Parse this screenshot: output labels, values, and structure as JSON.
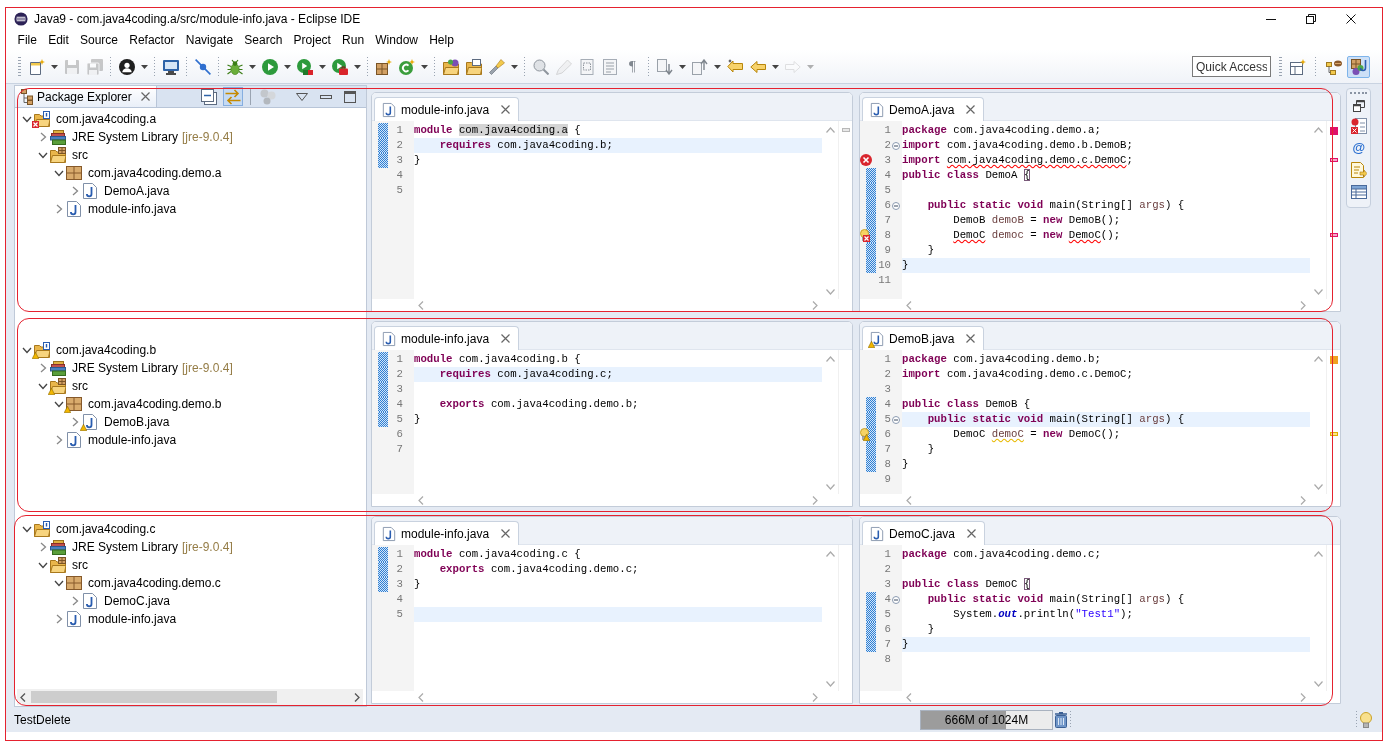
{
  "window": {
    "title": "Java9 - com.java4coding.a/src/module-info.java - Eclipse IDE"
  },
  "menu": [
    "File",
    "Edit",
    "Source",
    "Refactor",
    "Navigate",
    "Search",
    "Project",
    "Run",
    "Window",
    "Help"
  ],
  "toolbar": [
    [
      {
        "kind": "new",
        "dropdown": true,
        "disabled": false
      },
      {
        "kind": "save",
        "dropdown": false,
        "disabled": true
      },
      {
        "kind": "save-all",
        "dropdown": false,
        "disabled": true
      }
    ],
    [
      {
        "kind": "profile",
        "dropdown": true,
        "disabled": false
      }
    ],
    [
      {
        "kind": "console",
        "dropdown": false,
        "disabled": false
      }
    ],
    [
      {
        "kind": "skip-breakpoints",
        "dropdown": false,
        "disabled": false
      }
    ],
    [
      {
        "kind": "debug",
        "dropdown": true,
        "disabled": false
      },
      {
        "kind": "run",
        "dropdown": true,
        "disabled": false
      },
      {
        "kind": "coverage",
        "dropdown": true,
        "disabled": false
      },
      {
        "kind": "external-tools",
        "dropdown": true,
        "disabled": false
      }
    ],
    [
      {
        "kind": "new-package",
        "dropdown": false,
        "disabled": false
      },
      {
        "kind": "new-class",
        "dropdown": true,
        "disabled": false
      }
    ],
    [
      {
        "kind": "open-type",
        "dropdown": false,
        "disabled": false
      },
      {
        "kind": "open-task",
        "dropdown": false,
        "disabled": false
      },
      {
        "kind": "search",
        "dropdown": true,
        "disabled": false
      }
    ],
    [
      {
        "kind": "breadcrumb",
        "dropdown": false,
        "disabled": false
      },
      {
        "kind": "mark-occurrences",
        "dropdown": false,
        "disabled": true
      },
      {
        "kind": "block-selection",
        "dropdown": false,
        "disabled": false
      },
      {
        "kind": "word-wrap",
        "dropdown": false,
        "disabled": false
      },
      {
        "kind": "whitespace",
        "label": "¶",
        "dropdown": false,
        "disabled": false
      }
    ],
    [
      {
        "kind": "next-annotation",
        "dropdown": true,
        "disabled": false
      },
      {
        "kind": "previous-annotation",
        "dropdown": true,
        "disabled": false
      },
      {
        "kind": "last-edit",
        "dropdown": false,
        "disabled": false
      },
      {
        "kind": "back",
        "dropdown": true,
        "disabled": false
      },
      {
        "kind": "forward",
        "dropdown": true,
        "disabled": true
      }
    ]
  ],
  "quick_access": {
    "placeholder": "Quick Access"
  },
  "perspectives": [
    {
      "kind": "open-perspective",
      "selected": false
    },
    {
      "kind": "hierarchy",
      "selected": false
    },
    {
      "kind": "java",
      "selected": true
    }
  ],
  "package_explorer": {
    "title": "Package Explorer",
    "view_toolbar": [
      {
        "kind": "collapse-all",
        "selected": false
      },
      {
        "kind": "link-with-editor",
        "selected": true
      },
      {
        "kind": "focus-task",
        "selected": false
      },
      {
        "kind": "view-menu",
        "selected": false
      },
      {
        "kind": "minimize",
        "selected": false
      },
      {
        "kind": "maximize",
        "selected": false
      }
    ],
    "projects": [
      {
        "label": "com.java4coding.a",
        "kind": "project",
        "error": true,
        "warning": false,
        "expanded": true,
        "children": [
          {
            "label": "JRE System Library",
            "decoration": "[jre-9.0.4]",
            "kind": "library",
            "error": false,
            "warning": false,
            "expanded": false
          },
          {
            "label": "src",
            "kind": "source-folder",
            "error": false,
            "warning": false,
            "expanded": true,
            "children": [
              {
                "label": "com.java4coding.demo.a",
                "kind": "package",
                "error": false,
                "warning": false,
                "expanded": true,
                "children": [
                  {
                    "label": "DemoA.java",
                    "kind": "java-file",
                    "error": false,
                    "warning": false,
                    "expanded": false
                  }
                ]
              },
              {
                "label": "module-info.java",
                "kind": "java-file",
                "error": false,
                "warning": false,
                "expanded": false
              }
            ]
          }
        ]
      },
      {
        "label": "com.java4coding.b",
        "kind": "project",
        "error": false,
        "warning": true,
        "expanded": true,
        "children": [
          {
            "label": "JRE System Library",
            "decoration": "[jre-9.0.4]",
            "kind": "library",
            "error": false,
            "warning": false,
            "expanded": false
          },
          {
            "label": "src",
            "kind": "source-folder",
            "error": false,
            "warning": true,
            "expanded": true,
            "children": [
              {
                "label": "com.java4coding.demo.b",
                "kind": "package",
                "error": false,
                "warning": true,
                "expanded": true,
                "children": [
                  {
                    "label": "DemoB.java",
                    "kind": "java-file",
                    "error": false,
                    "warning": true,
                    "expanded": false
                  }
                ]
              },
              {
                "label": "module-info.java",
                "kind": "java-file",
                "error": false,
                "warning": false,
                "expanded": false
              }
            ]
          }
        ]
      },
      {
        "label": "com.java4coding.c",
        "kind": "project",
        "error": false,
        "warning": false,
        "expanded": true,
        "children": [
          {
            "label": "JRE System Library",
            "decoration": "[jre-9.0.4]",
            "kind": "library",
            "error": false,
            "warning": false,
            "expanded": false
          },
          {
            "label": "src",
            "kind": "source-folder",
            "error": false,
            "warning": false,
            "expanded": true,
            "children": [
              {
                "label": "com.java4coding.demo.c",
                "kind": "package",
                "error": false,
                "warning": false,
                "expanded": true,
                "children": [
                  {
                    "label": "DemoC.java",
                    "kind": "java-file",
                    "error": false,
                    "warning": false,
                    "expanded": false
                  }
                ]
              },
              {
                "label": "module-info.java",
                "kind": "java-file",
                "error": false,
                "warning": false,
                "expanded": false
              }
            ]
          }
        ]
      }
    ]
  },
  "editor_rows": [
    {
      "editors": [
        {
          "tab": {
            "title": "module-info.java",
            "error": false,
            "warning": false
          },
          "lines": [
            {
              "number": "1",
              "tokens": [
                {
                  "kind": "keyword",
                  "text": "module "
                },
                {
                  "kind": "occurrence",
                  "text": "com.java4coding.a"
                },
                {
                  "kind": "plain",
                  "text": " {"
                }
              ],
              "current": false,
              "changed": true,
              "fold": false,
              "error": false,
              "warning": false,
              "quickfix": false
            },
            {
              "number": "2",
              "tokens": [
                {
                  "kind": "keyword",
                  "text": "    requires"
                },
                {
                  "kind": "plain",
                  "text": " com.java4coding.b;"
                }
              ],
              "current": true,
              "changed": true,
              "fold": false,
              "error": false,
              "warning": false,
              "quickfix": false
            },
            {
              "number": "3",
              "tokens": [
                {
                  "kind": "plain",
                  "text": "}"
                }
              ],
              "current": false,
              "changed": true,
              "fold": false,
              "error": false,
              "warning": false,
              "quickfix": false
            },
            {
              "number": "4",
              "current": false,
              "changed": false,
              "fold": false,
              "error": false,
              "warning": false,
              "quickfix": false
            },
            {
              "number": "5",
              "current": false,
              "changed": false,
              "fold": false,
              "error": false,
              "warning": false,
              "quickfix": false
            }
          ]
        },
        {
          "tab": {
            "title": "DemoA.java",
            "error": false,
            "warning": false
          },
          "lines": [
            {
              "number": "1",
              "tokens": [
                {
                  "kind": "keyword",
                  "text": "package"
                },
                {
                  "kind": "plain",
                  "text": " com.java4coding.demo.a;"
                }
              ],
              "current": false,
              "changed": false,
              "fold": false,
              "error": false,
              "warning": false,
              "quickfix": false
            },
            {
              "number": "2",
              "tokens": [
                {
                  "kind": "keyword",
                  "text": "import"
                },
                {
                  "kind": "plain",
                  "text": " com.java4coding.demo.b.DemoB;"
                }
              ],
              "current": false,
              "changed": false,
              "fold": true,
              "error": false,
              "warning": false,
              "quickfix": false
            },
            {
              "number": "3",
              "tokens": [
                {
                  "kind": "keyword",
                  "text": "import "
                },
                {
                  "kind": "error",
                  "text": "com.java4coding.demo.c.DemoC"
                },
                {
                  "kind": "plain",
                  "text": ";"
                }
              ],
              "current": false,
              "changed": false,
              "fold": false,
              "error": true,
              "warning": false,
              "quickfix": false
            },
            {
              "number": "4",
              "tokens": [
                {
                  "kind": "keyword",
                  "text": "public class"
                },
                {
                  "kind": "plain",
                  "text": " DemoA "
                },
                {
                  "kind": "bracket",
                  "text": "{"
                }
              ],
              "current": false,
              "changed": true,
              "fold": false,
              "error": false,
              "warning": false,
              "quickfix": false
            },
            {
              "number": "5",
              "current": false,
              "changed": true,
              "fold": false,
              "error": false,
              "warning": false,
              "quickfix": false
            },
            {
              "number": "6",
              "tokens": [
                {
                  "kind": "keyword",
                  "text": "    public static void"
                },
                {
                  "kind": "plain",
                  "text": " main(String[] "
                },
                {
                  "kind": "variable",
                  "text": "args"
                },
                {
                  "kind": "plain",
                  "text": ") {"
                }
              ],
              "current": false,
              "changed": true,
              "fold": true,
              "error": false,
              "warning": false,
              "quickfix": false
            },
            {
              "number": "7",
              "tokens": [
                {
                  "kind": "plain",
                  "text": "        DemoB "
                },
                {
                  "kind": "variable",
                  "text": "demoB"
                },
                {
                  "kind": "plain",
                  "text": " = "
                },
                {
                  "kind": "keyword",
                  "text": "new"
                },
                {
                  "kind": "plain",
                  "text": " DemoB();"
                }
              ],
              "current": false,
              "changed": true,
              "fold": false,
              "error": false,
              "warning": false,
              "quickfix": false
            },
            {
              "number": "8",
              "tokens": [
                {
                  "kind": "error",
                  "text": "        DemoC"
                },
                {
                  "kind": "variable",
                  "text": " democ"
                },
                {
                  "kind": "plain",
                  "text": " = "
                },
                {
                  "kind": "keyword",
                  "text": "new "
                },
                {
                  "kind": "error",
                  "text": "DemoC"
                },
                {
                  "kind": "plain",
                  "text": "();"
                }
              ],
              "current": false,
              "changed": true,
              "fold": false,
              "error": true,
              "warning": false,
              "quickfix": true
            },
            {
              "number": "9",
              "tokens": [
                {
                  "kind": "plain",
                  "text": "    }"
                }
              ],
              "current": false,
              "changed": true,
              "fold": false,
              "error": false,
              "warning": false,
              "quickfix": false
            },
            {
              "number": "10",
              "tokens": [
                {
                  "kind": "plain",
                  "text": "}"
                }
              ],
              "current": true,
              "changed": true,
              "fold": false,
              "error": false,
              "warning": false,
              "quickfix": false
            },
            {
              "number": "11",
              "current": false,
              "changed": false,
              "fold": false,
              "error": false,
              "warning": false,
              "quickfix": false
            }
          ]
        }
      ]
    },
    {
      "editors": [
        {
          "tab": {
            "title": "module-info.java",
            "error": false,
            "warning": false
          },
          "lines": [
            {
              "number": "1",
              "tokens": [
                {
                  "kind": "keyword",
                  "text": "module"
                },
                {
                  "kind": "plain",
                  "text": " com.java4coding.b {"
                }
              ],
              "current": false,
              "changed": true,
              "fold": false,
              "error": false,
              "warning": false,
              "quickfix": false
            },
            {
              "number": "2",
              "tokens": [
                {
                  "kind": "keyword",
                  "text": "    requires"
                },
                {
                  "kind": "plain",
                  "text": " com.java4coding.c;"
                }
              ],
              "current": true,
              "changed": true,
              "fold": false,
              "error": false,
              "warning": false,
              "quickfix": false
            },
            {
              "number": "3",
              "current": false,
              "changed": true,
              "fold": false,
              "error": false,
              "warning": false,
              "quickfix": false
            },
            {
              "number": "4",
              "tokens": [
                {
                  "kind": "keyword",
                  "text": "    exports"
                },
                {
                  "kind": "plain",
                  "text": " com.java4coding.demo.b;"
                }
              ],
              "current": false,
              "changed": true,
              "fold": false,
              "error": false,
              "warning": false,
              "quickfix": false
            },
            {
              "number": "5",
              "tokens": [
                {
                  "kind": "plain",
                  "text": "}"
                }
              ],
              "current": false,
              "changed": true,
              "fold": false,
              "error": false,
              "warning": false,
              "quickfix": false
            },
            {
              "number": "6",
              "current": false,
              "changed": false,
              "fold": false,
              "error": false,
              "warning": false,
              "quickfix": false
            },
            {
              "number": "7",
              "current": false,
              "changed": false,
              "fold": false,
              "error": false,
              "warning": false,
              "quickfix": false
            }
          ]
        },
        {
          "tab": {
            "title": "DemoB.java",
            "error": false,
            "warning": true
          },
          "lines": [
            {
              "number": "1",
              "tokens": [
                {
                  "kind": "keyword",
                  "text": "package"
                },
                {
                  "kind": "plain",
                  "text": " com.java4coding.demo.b;"
                }
              ],
              "current": false,
              "changed": false,
              "fold": false,
              "error": false,
              "warning": false,
              "quickfix": false
            },
            {
              "number": "2",
              "tokens": [
                {
                  "kind": "keyword",
                  "text": "import"
                },
                {
                  "kind": "plain",
                  "text": " com.java4coding.demo.c.DemoC;"
                }
              ],
              "current": false,
              "changed": false,
              "fold": false,
              "error": false,
              "warning": false,
              "quickfix": false
            },
            {
              "number": "3",
              "current": false,
              "changed": false,
              "fold": false,
              "error": false,
              "warning": false,
              "quickfix": false
            },
            {
              "number": "4",
              "tokens": [
                {
                  "kind": "keyword",
                  "text": "public class"
                },
                {
                  "kind": "plain",
                  "text": " DemoB {"
                }
              ],
              "current": false,
              "changed": true,
              "fold": false,
              "error": false,
              "warning": false,
              "quickfix": false
            },
            {
              "number": "5",
              "tokens": [
                {
                  "kind": "keyword",
                  "text": "    public static void"
                },
                {
                  "kind": "plain",
                  "text": " main(String[] "
                },
                {
                  "kind": "variable",
                  "text": "args"
                },
                {
                  "kind": "plain",
                  "text": ") {"
                }
              ],
              "current": true,
              "changed": true,
              "fold": true,
              "error": false,
              "warning": false,
              "quickfix": false
            },
            {
              "number": "6",
              "tokens": [
                {
                  "kind": "plain",
                  "text": "        DemoC "
                },
                {
                  "kind": "warning",
                  "text": "demoC"
                },
                {
                  "kind": "plain",
                  "text": " = "
                },
                {
                  "kind": "keyword",
                  "text": "new"
                },
                {
                  "kind": "plain",
                  "text": " DemoC();"
                }
              ],
              "current": false,
              "changed": true,
              "fold": false,
              "error": false,
              "warning": true,
              "quickfix": true
            },
            {
              "number": "7",
              "tokens": [
                {
                  "kind": "plain",
                  "text": "    }"
                }
              ],
              "current": false,
              "changed": true,
              "fold": false,
              "error": false,
              "warning": false,
              "quickfix": false
            },
            {
              "number": "8",
              "tokens": [
                {
                  "kind": "plain",
                  "text": "}"
                }
              ],
              "current": false,
              "changed": true,
              "fold": false,
              "error": false,
              "warning": false,
              "quickfix": false
            },
            {
              "number": "9",
              "current": false,
              "changed": false,
              "fold": false,
              "error": false,
              "warning": false,
              "quickfix": false
            }
          ]
        }
      ]
    },
    {
      "editors": [
        {
          "tab": {
            "title": "module-info.java",
            "error": false,
            "warning": false
          },
          "lines": [
            {
              "number": "1",
              "tokens": [
                {
                  "kind": "keyword",
                  "text": "module"
                },
                {
                  "kind": "plain",
                  "text": " com.java4coding.c {"
                }
              ],
              "current": false,
              "changed": true,
              "fold": false,
              "error": false,
              "warning": false,
              "quickfix": false
            },
            {
              "number": "2",
              "tokens": [
                {
                  "kind": "keyword",
                  "text": "    exports"
                },
                {
                  "kind": "plain",
                  "text": " com.java4coding.demo.c;"
                }
              ],
              "current": false,
              "changed": true,
              "fold": false,
              "error": false,
              "warning": false,
              "quickfix": false
            },
            {
              "number": "3",
              "tokens": [
                {
                  "kind": "plain",
                  "text": "}"
                }
              ],
              "current": false,
              "changed": true,
              "fold": false,
              "error": false,
              "warning": false,
              "quickfix": false
            },
            {
              "number": "4",
              "current": false,
              "changed": false,
              "fold": false,
              "error": false,
              "warning": false,
              "quickfix": false
            },
            {
              "number": "5",
              "current": true,
              "changed": false,
              "fold": false,
              "error": false,
              "warning": false,
              "quickfix": false
            }
          ]
        },
        {
          "tab": {
            "title": "DemoC.java",
            "error": false,
            "warning": false
          },
          "lines": [
            {
              "number": "1",
              "tokens": [
                {
                  "kind": "keyword",
                  "text": "package"
                },
                {
                  "kind": "plain",
                  "text": " com.java4coding.demo.c;"
                }
              ],
              "current": false,
              "changed": false,
              "fold": false,
              "error": false,
              "warning": false,
              "quickfix": false
            },
            {
              "number": "2",
              "current": false,
              "changed": false,
              "fold": false,
              "error": false,
              "warning": false,
              "quickfix": false
            },
            {
              "number": "3",
              "tokens": [
                {
                  "kind": "keyword",
                  "text": "public class"
                },
                {
                  "kind": "plain",
                  "text": " DemoC "
                },
                {
                  "kind": "bracket",
                  "text": "{"
                }
              ],
              "current": false,
              "changed": false,
              "fold": false,
              "error": false,
              "warning": false,
              "quickfix": false
            },
            {
              "number": "4",
              "tokens": [
                {
                  "kind": "keyword",
                  "text": "    public static void"
                },
                {
                  "kind": "plain",
                  "text": " main(String[] "
                },
                {
                  "kind": "variable",
                  "text": "args"
                },
                {
                  "kind": "plain",
                  "text": ") {"
                }
              ],
              "current": false,
              "changed": true,
              "fold": true,
              "error": false,
              "warning": false,
              "quickfix": false
            },
            {
              "number": "5",
              "tokens": [
                {
                  "kind": "plain",
                  "text": "        System."
                },
                {
                  "kind": "static-field",
                  "text": "out"
                },
                {
                  "kind": "plain",
                  "text": ".println("
                },
                {
                  "kind": "string",
                  "text": "\"Test1\""
                },
                {
                  "kind": "plain",
                  "text": ");"
                }
              ],
              "current": false,
              "changed": true,
              "fold": false,
              "error": false,
              "warning": false,
              "quickfix": false
            },
            {
              "number": "6",
              "tokens": [
                {
                  "kind": "plain",
                  "text": "    }"
                }
              ],
              "current": false,
              "changed": true,
              "fold": false,
              "error": false,
              "warning": false,
              "quickfix": false
            },
            {
              "number": "7",
              "tokens": [
                {
                  "kind": "plain",
                  "text": "}"
                }
              ],
              "current": true,
              "changed": true,
              "fold": false,
              "error": false,
              "warning": false,
              "quickfix": false
            },
            {
              "number": "8",
              "current": false,
              "changed": false,
              "fold": false,
              "error": false,
              "warning": false,
              "quickfix": false
            }
          ]
        }
      ]
    }
  ],
  "right_trim": {
    "items": [
      {
        "kind": "restore"
      },
      {
        "kind": "problems"
      },
      {
        "kind": "javadoc",
        "label": "@"
      },
      {
        "kind": "declaration"
      },
      {
        "kind": "table"
      }
    ]
  },
  "status_bar": {
    "message": "TestDelete",
    "memory": {
      "text": "666M of 1024M",
      "level": 0.65
    }
  }
}
